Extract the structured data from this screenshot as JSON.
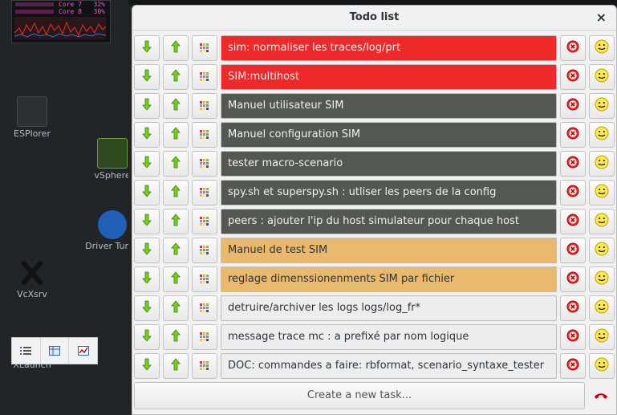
{
  "desktop": {
    "cpu": [
      {
        "label": "Core 7",
        "pct": "32%"
      },
      {
        "label": "Core 8",
        "pct": "30%"
      }
    ],
    "icons": [
      {
        "label": "ESPlorer"
      },
      {
        "label": "vSphere"
      },
      {
        "label": "Driver Tuner"
      },
      {
        "label": "VcXsrv"
      },
      {
        "label": "XLaunch"
      }
    ]
  },
  "window": {
    "title": "Todo list",
    "close_glyph": "×"
  },
  "tasks": [
    {
      "text": "sim: normaliser les traces/log/prt",
      "color": "#ef2929"
    },
    {
      "text": "SIM:multihost",
      "color": "#ef2929"
    },
    {
      "text": "Manuel utilisateur SIM",
      "color": "#555753"
    },
    {
      "text": "Manuel configuration SIM",
      "color": "#555753"
    },
    {
      "text": "tester macro-scenario",
      "color": "#555753"
    },
    {
      "text": "spy.sh et superspy.sh : utliser les peers de la config",
      "color": "#555753"
    },
    {
      "text": "peers : ajouter l'ip du host simulateur pour chaque host",
      "color": "#555753"
    },
    {
      "text": "Manuel de test SIM",
      "color": "#e9b96e"
    },
    {
      "text": "reglage dimenssionenments SIM par fichier",
      "color": "#e9b96e"
    },
    {
      "text": "detruire/archiver les logs logs/log_fr*",
      "color": "#ededed"
    },
    {
      "text": "message trace mc : a prefixé par nom logique",
      "color": "#ededed"
    },
    {
      "text": "DOC: commandes a faire:  rbformat, scenario_syntaxe_tester",
      "color": "#ededed"
    }
  ],
  "footer": {
    "create_label": "Create a new task..."
  },
  "icons": {
    "move_down": "arrow-down-icon",
    "move_up": "arrow-up-icon",
    "color": "color-palette-icon",
    "delete": "delete-icon",
    "mood": "smiley-icon",
    "hangup": "hang-up-icon"
  }
}
